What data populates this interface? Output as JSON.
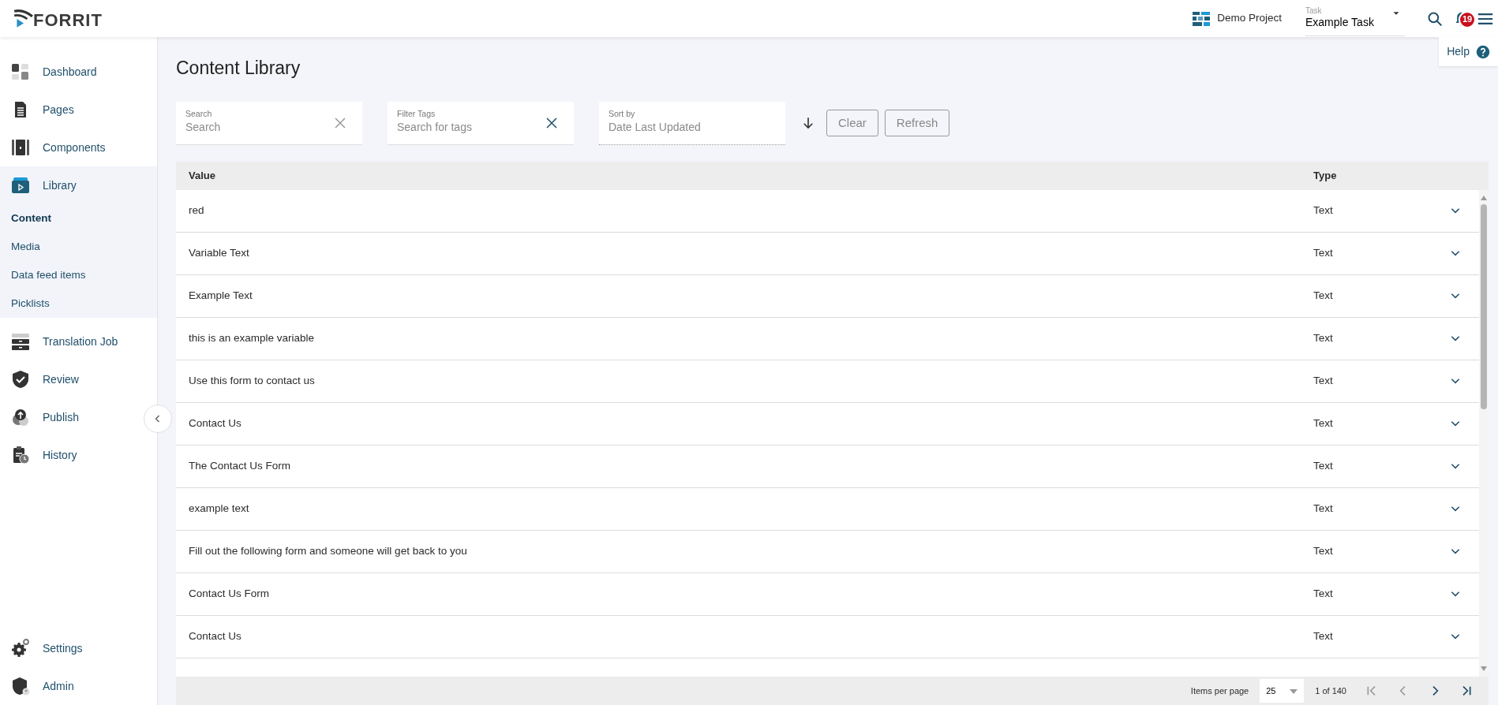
{
  "header": {
    "logo": "FORRIT",
    "project": "Demo Project",
    "task": {
      "label": "Task",
      "value": "Example Task"
    },
    "notifications": "19",
    "help": "Help"
  },
  "sidebar": {
    "items": [
      {
        "label": "Dashboard",
        "selected": false
      },
      {
        "label": "Pages",
        "selected": false
      },
      {
        "label": "Components",
        "selected": false
      },
      {
        "label": "Library",
        "selected": false,
        "expanded": true,
        "children": [
          {
            "label": "Content",
            "selected": true
          },
          {
            "label": "Media",
            "selected": false
          },
          {
            "label": "Data feed items",
            "selected": false
          },
          {
            "label": "Picklists",
            "selected": false
          }
        ]
      },
      {
        "label": "Translation Job",
        "selected": false
      },
      {
        "label": "Review",
        "selected": false
      },
      {
        "label": "Publish",
        "selected": false
      },
      {
        "label": "History",
        "selected": false
      }
    ],
    "bottom_items": [
      {
        "label": "Settings",
        "selected": false
      },
      {
        "label": "Admin",
        "selected": false
      }
    ]
  },
  "page_title": "Content Library",
  "filters": [
    {
      "kind": "text",
      "label": "Search",
      "placeholder": "Search"
    },
    {
      "kind": "tags",
      "label": "Filter Tags",
      "placeholder": "Search for tags"
    },
    {
      "kind": "select",
      "label": "Sort by",
      "placeholder": "Date Last Updated"
    }
  ],
  "buttons": [
    "Clear",
    "Refresh"
  ],
  "table": {
    "columns": [
      "Value",
      "Type"
    ],
    "rows": [
      {
        "value": "red",
        "type": "Text"
      },
      {
        "value": "Variable Text",
        "type": "Text"
      },
      {
        "value": "Example Text",
        "type": "Text"
      },
      {
        "value": "this is an example variable",
        "type": "Text"
      },
      {
        "value": "Use this form to contact us",
        "type": "Text"
      },
      {
        "value": "Contact Us",
        "type": "Text"
      },
      {
        "value": "The Contact Us Form",
        "type": "Text"
      },
      {
        "value": "example text",
        "type": "Text"
      },
      {
        "value": "Fill out the following form and someone will get back to you",
        "type": "Text"
      },
      {
        "value": "Contact Us Form",
        "type": "Text"
      },
      {
        "value": "Contact Us",
        "type": "Text"
      }
    ]
  },
  "pagination": {
    "label": "Items per page",
    "per_page": "25",
    "range": "1 of 140"
  }
}
